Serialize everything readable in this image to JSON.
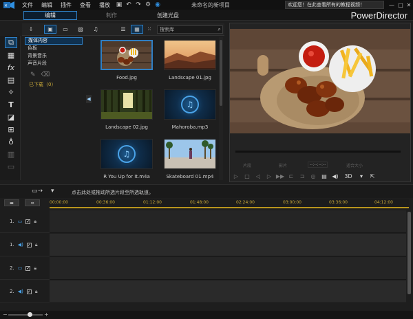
{
  "menubar": {
    "items": [
      "文件",
      "编辑",
      "插件",
      "查看",
      "播放"
    ],
    "project_title": "未命名的新项目",
    "welcome": "欢迎您！在此查看所有的教程视频！",
    "minimize": "—",
    "maximize": "□",
    "close": "✕"
  },
  "modes": {
    "edit": "编辑",
    "produce": "制作",
    "create_disc": "创建光盘"
  },
  "brand": "PowerDirector",
  "library": {
    "search_placeholder": "搜索库",
    "categories": [
      "媒体内容",
      "色板",
      "背景音乐",
      "声音片段"
    ],
    "footer": "已下载（0）",
    "items": [
      {
        "name": "Food.jpg",
        "kind": "image"
      },
      {
        "name": "Landscape 01.jpg",
        "kind": "image"
      },
      {
        "name": "Landscape 02.jpg",
        "kind": "image"
      },
      {
        "name": "Mahoroba.mp3",
        "kind": "audio"
      },
      {
        "name": "R You Up for It.m4a",
        "kind": "audio"
      },
      {
        "name": "Skateboard 01.mp4",
        "kind": "video"
      }
    ]
  },
  "preview": {
    "left_label": "片段",
    "mid_label": "影片",
    "timecode": "--:--:--:--",
    "zoom_label": "适合大小",
    "mode_3d": "3D"
  },
  "timeline": {
    "hint": "点击此处或拖动所选片段至所选轨道。",
    "ruler": [
      "00:00:00",
      "00:36:00",
      "01:12:00",
      "01:48:00",
      "02:24:00",
      "03:00:00",
      "03:36:00",
      "04:12:00"
    ],
    "tracks": [
      {
        "label": "1.",
        "type": "video"
      },
      {
        "label": "1.",
        "type": "audio"
      },
      {
        "label": "2.",
        "type": "video"
      },
      {
        "label": "2.",
        "type": "audio"
      }
    ]
  }
}
